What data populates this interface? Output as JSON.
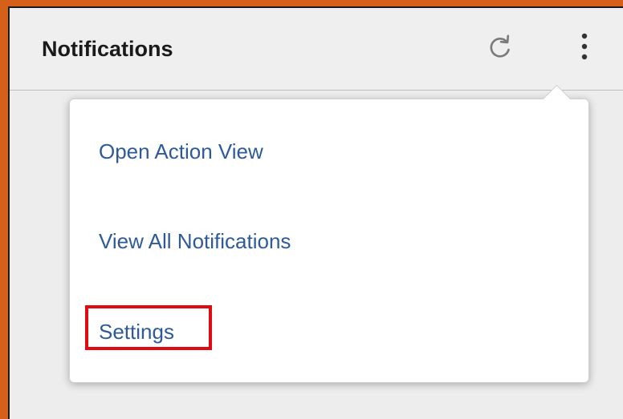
{
  "panel": {
    "title": "Notifications",
    "refresh_icon": "refresh-icon",
    "more_icon": "vertical-dots-icon"
  },
  "menu": {
    "items": [
      {
        "label": "Open Action View"
      },
      {
        "label": "View All Notifications"
      },
      {
        "label": "Settings"
      }
    ],
    "highlighted_item": "Settings",
    "highlight_color": "#e00b12",
    "link_color": "#2e5a9a"
  },
  "colors": {
    "outer_border": "#d4601a",
    "panel_background": "#efefef"
  }
}
